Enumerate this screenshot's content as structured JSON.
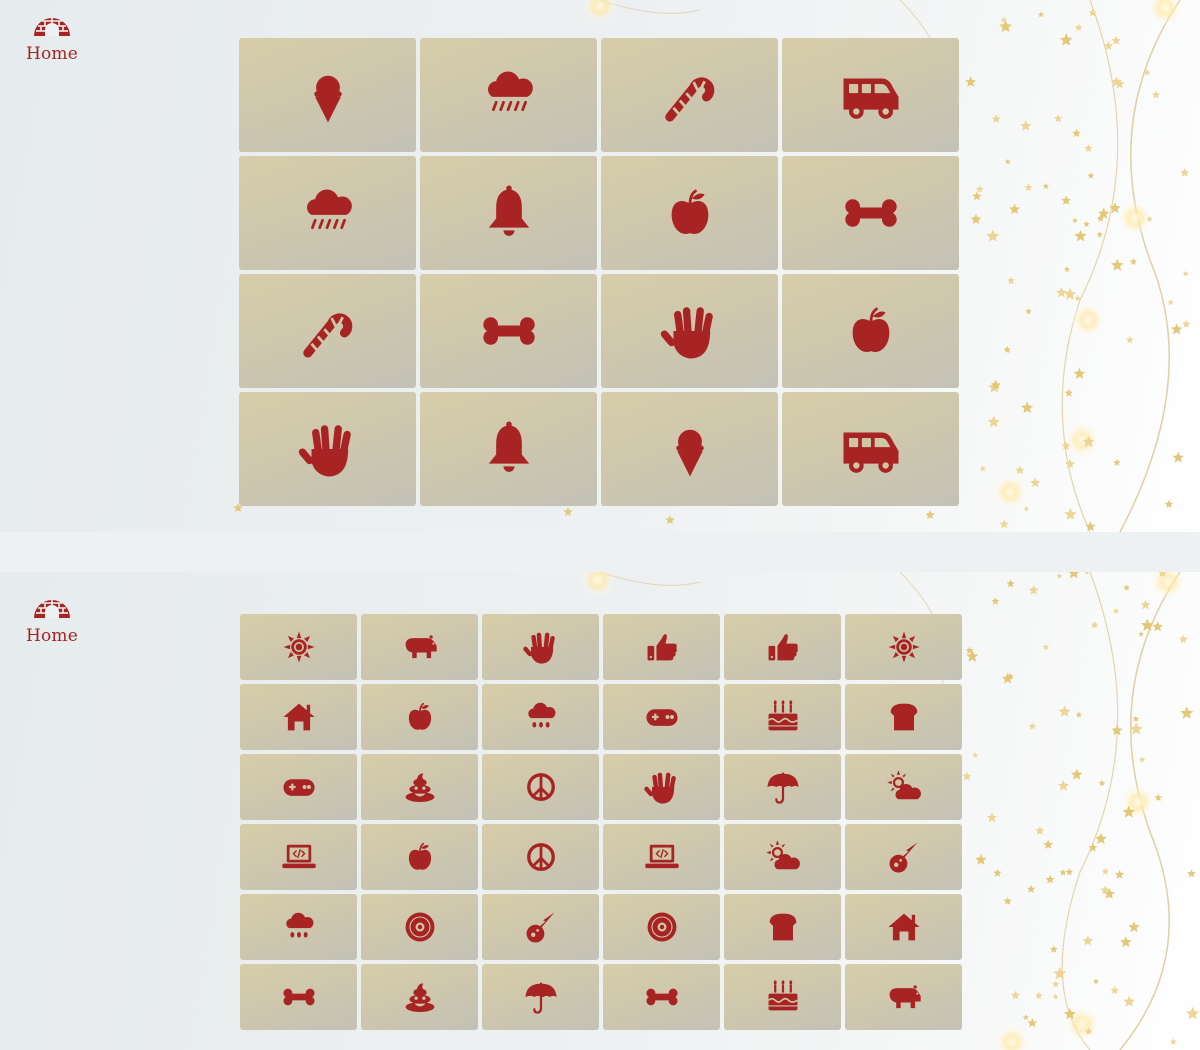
{
  "colors": {
    "icon": "#a82323",
    "card": "#cfc6a6",
    "background": "#eef1f2"
  },
  "screens": [
    {
      "nav": {
        "home_label": "Home",
        "home_icon": "igloo-icon"
      },
      "grid": {
        "columns": 4,
        "rows": 4,
        "cards": [
          "ice-cream",
          "cloud-rain",
          "candy-cane",
          "van",
          "cloud-rain",
          "bell",
          "apple",
          "bone",
          "candy-cane",
          "bone",
          "hand-spock",
          "apple",
          "hand-spock",
          "bell",
          "ice-cream",
          "van"
        ]
      }
    },
    {
      "nav": {
        "home_label": "Home",
        "home_icon": "igloo-icon"
      },
      "grid": {
        "columns": 6,
        "rows": 6,
        "cards": [
          "sun",
          "hippo",
          "hand-spock",
          "thumbs-up",
          "thumbs-up",
          "sun",
          "house",
          "apple",
          "cloud-showers",
          "gamepad",
          "birthday-cake",
          "bread",
          "gamepad",
          "poop",
          "peace",
          "hand-spock",
          "umbrella",
          "cloud-sun",
          "laptop-code",
          "apple",
          "peace",
          "laptop-code",
          "cloud-sun",
          "meteor",
          "cloud-showers",
          "record",
          "meteor",
          "record",
          "bread",
          "house",
          "bone",
          "poop",
          "umbrella",
          "bone",
          "birthday-cake",
          "hippo"
        ]
      }
    }
  ]
}
